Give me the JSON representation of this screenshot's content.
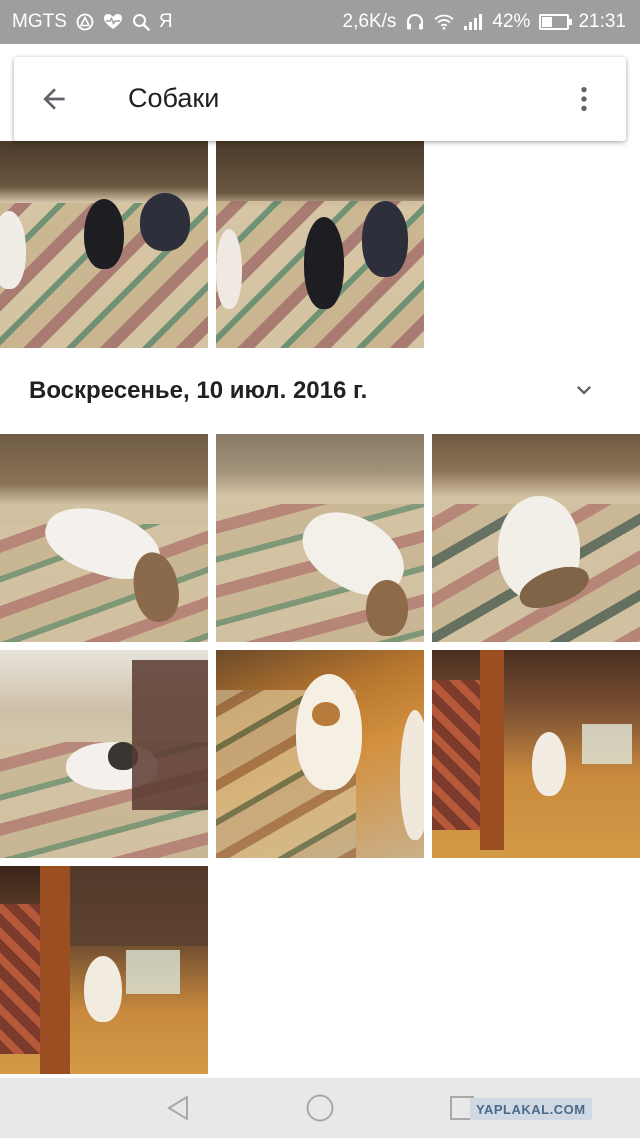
{
  "status_bar": {
    "carrier": "MGTS",
    "app_letter": "Я",
    "network_speed": "2,6K/s",
    "battery_percent_text": "42%",
    "battery_level": 0.42,
    "time": "21:31"
  },
  "app_bar": {
    "title": "Собаки",
    "back_icon": "arrow-back-icon",
    "more_icon": "more-vert-icon"
  },
  "section": {
    "date": "Воскресенье, 10 июл. 2016 г.",
    "toggle_icon": "chevron-down-icon"
  },
  "nav_bar": {
    "back_icon": "nav-back-icon",
    "home_icon": "nav-home-icon",
    "recents_icon": "nav-recents-icon"
  },
  "watermark": "YAPLAKAL.COM",
  "colors": {
    "status_bar_bg": "#9e9e9e",
    "text_primary": "#212121",
    "icon_gray": "#5f6368",
    "nav_bar_bg": "#e8e8e8"
  }
}
